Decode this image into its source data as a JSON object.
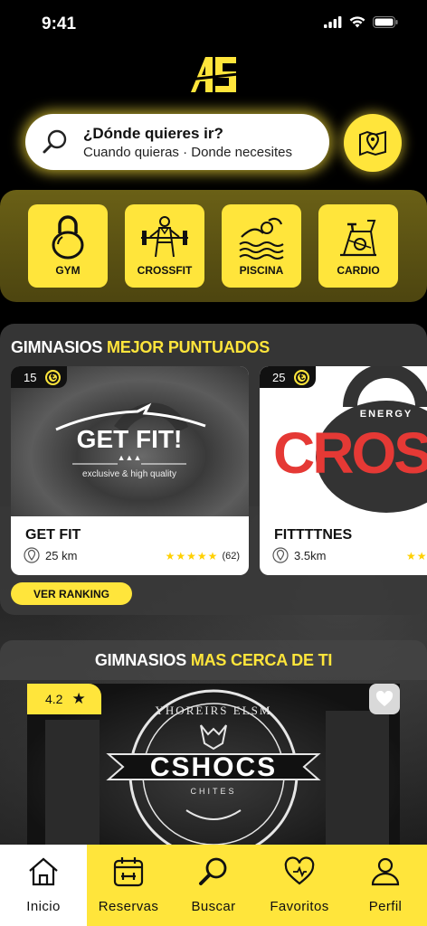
{
  "status_bar": {
    "time": "9:41"
  },
  "app": {
    "logo_text": "AG"
  },
  "search": {
    "title": "¿Dónde quieres ir?",
    "subtitle": "Cuando quieras · Donde necesites",
    "icon": "search-icon",
    "map_icon": "map-pin-icon"
  },
  "categories": [
    {
      "label": "GYM",
      "icon": "kettlebell-icon"
    },
    {
      "label": "CROSSFIT",
      "icon": "weightlifter-icon"
    },
    {
      "label": "PISCINA",
      "icon": "swimmer-icon"
    },
    {
      "label": "CARDIO",
      "icon": "stationary-bike-icon"
    }
  ],
  "best_rated": {
    "title_white": "GIMNASIOS ",
    "title_yellow": "MEJOR PUNTUADOS",
    "cards": [
      {
        "price": "15",
        "coin": "€",
        "name": "GET FIT",
        "distance": "25 km",
        "stars": "★★★★★",
        "reviews": "(62)",
        "logo_title": "GET FIT!",
        "logo_tagline": "exclusive & high quality"
      },
      {
        "price": "25",
        "coin": "€",
        "name": "FITTTTNES",
        "distance": "3.5km",
        "stars": "★★",
        "reviews": "",
        "logo_small": "ENERGY",
        "logo_big": "CROSS"
      }
    ],
    "ranking_button": "VER RANKING"
  },
  "nearby": {
    "title_white": "GIMNASIOS ",
    "title_yellow": "MAS CERCA DE TI",
    "card": {
      "rating": "4.2",
      "rating_icon": "star-icon",
      "favorite_icon": "heart-icon",
      "logo_name": "CSHOCS",
      "logo_sub": "CHITES",
      "logo_arc": "YHOREIRS ELSM"
    }
  },
  "nav": [
    {
      "label": "Inicio",
      "icon": "home-icon",
      "active": true
    },
    {
      "label": "Reservas",
      "icon": "calendar-icon"
    },
    {
      "label": "Buscar",
      "icon": "search-icon"
    },
    {
      "label": "Favoritos",
      "icon": "heart-icon"
    },
    {
      "label": "Perfil",
      "icon": "user-icon"
    }
  ],
  "colors": {
    "accent": "#FFE53B",
    "background": "#000000",
    "card": "#FFFFFF"
  }
}
